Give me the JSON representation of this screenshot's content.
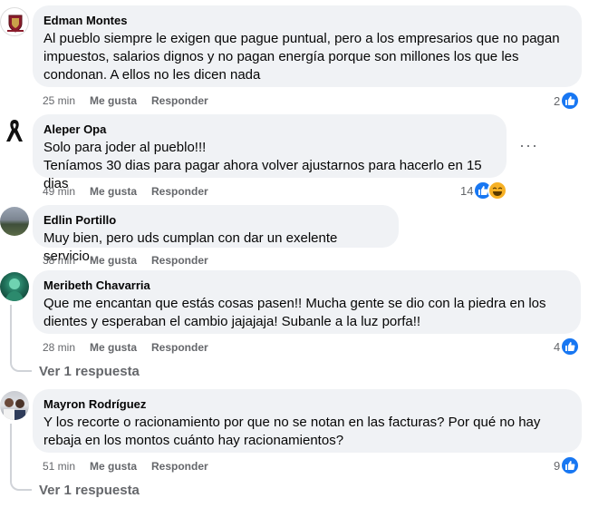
{
  "comments": [
    {
      "author": "Edman Montes",
      "text": "Al pueblo siempre le exigen que pague puntual, pero a los empresarios que no pagan\nimpuestos, salarios dignos y no pagan energía porque son millones los que les\ncondonan. A ellos no les dicen nada",
      "time": "25 min",
      "like_label": "Me gusta",
      "reply_label": "Responder",
      "reaction_count": "2"
    },
    {
      "author": "Aleper Opa",
      "text": "Solo para joder al pueblo!!!\nTeníamos 30 dias para pagar ahora volver ajustarnos para hacerlo en 15 dias",
      "time": "49 min",
      "like_label": "Me gusta",
      "reply_label": "Responder",
      "reaction_count": "14",
      "more_label": "···"
    },
    {
      "author": "Edlin Portillo",
      "text": "Muy bien, pero uds cumplan con dar un exelente servicio.",
      "time": "38 min",
      "like_label": "Me gusta",
      "reply_label": "Responder"
    },
    {
      "author": "Meribeth Chavarria",
      "text": "Que me encantan que estás cosas pasen!! Mucha gente se dio con la piedra en los\ndientes y esperaban el cambio jajajaja! Subanle a la luz porfa!!",
      "time": "28 min",
      "like_label": "Me gusta",
      "reply_label": "Responder",
      "reaction_count": "4",
      "replies_label": "Ver 1 respuesta"
    },
    {
      "author": "Mayron Rodríguez",
      "text": "Y los recorte o racionamiento por que no se notan en las facturas? Por qué no hay\nrebaja en los montos cuánto hay racionamientos?",
      "time": "51 min",
      "like_label": "Me gusta",
      "reply_label": "Responder",
      "reaction_count": "9",
      "replies_label": "Ver 1 respuesta"
    }
  ],
  "colors": {
    "bubble": "#f0f2f5",
    "secondary_text": "#65676b",
    "like_blue": "#1877f2",
    "haha_yellow": "#f7b125"
  }
}
